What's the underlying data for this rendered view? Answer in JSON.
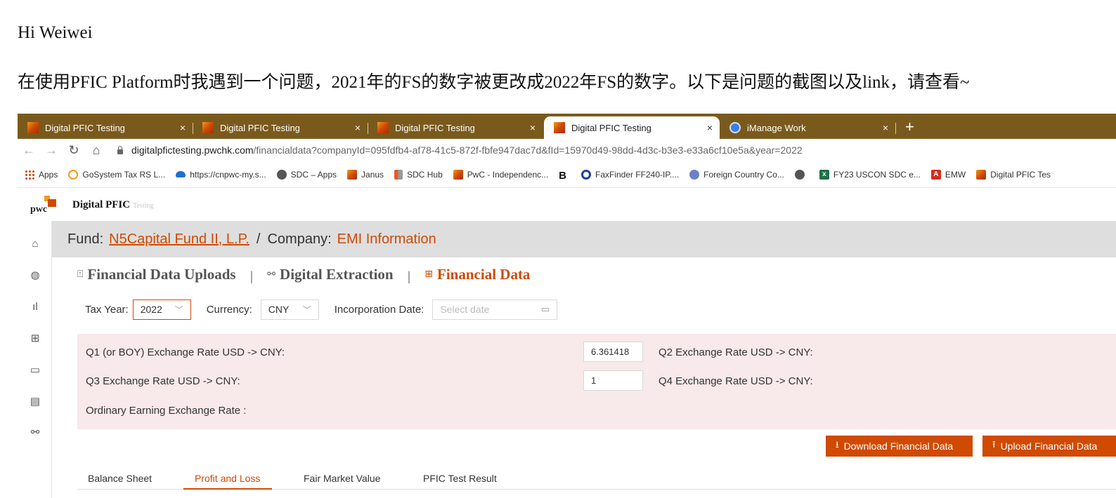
{
  "email": {
    "greeting": "Hi Weiwei",
    "message": "在使用PFIC Platform时我遇到一个问题，2021年的FS的数字被更改成2022年FS的数字。以下是问题的截图以及link，请查看~"
  },
  "browser": {
    "tabs": [
      {
        "title": "Digital PFIC Testing",
        "icon": "pwc-favicon"
      },
      {
        "title": "Digital PFIC Testing",
        "icon": "pwc-favicon"
      },
      {
        "title": "Digital PFIC Testing",
        "icon": "pwc-favicon"
      },
      {
        "title": "Digital PFIC Testing",
        "icon": "pwc-favicon",
        "active": true
      },
      {
        "title": "iManage Work",
        "icon": "imanage-favicon"
      }
    ],
    "close_glyph": "×",
    "new_tab_glyph": "+",
    "address": {
      "host": "digitalpfictesting.pwchk.com",
      "path": "/financialdata?companyId=095fdfb4-af78-41c5-872f-fbfe947dac7d&fId=15970d49-98dd-4d3c-b3e3-e33a6cf10e5a&year=2022"
    },
    "bookmarks": [
      {
        "label": "Apps",
        "icon": "apps-grid-icon"
      },
      {
        "label": "GoSystem Tax RS L...",
        "icon": "gosystem-icon"
      },
      {
        "label": "https://cnpwc-my.s...",
        "icon": "onedrive-cloud-icon"
      },
      {
        "label": "SDC – Apps",
        "icon": "globe-icon"
      },
      {
        "label": "Janus",
        "icon": "pwc-favicon"
      },
      {
        "label": "SDC Hub",
        "icon": "hub-icon"
      },
      {
        "label": "PwC - Independenc...",
        "icon": "pwc-favicon"
      },
      {
        "label": "",
        "icon": "bold-b-icon",
        "glyph": "B"
      },
      {
        "label": "FaxFinder FF240-IP....",
        "icon": "faxfinder-icon"
      },
      {
        "label": "Foreign Country Co...",
        "icon": "foreign-icon"
      },
      {
        "label": "",
        "icon": "globe-icon"
      },
      {
        "label": "FY23 USCON SDC e...",
        "icon": "excel-icon",
        "glyph": "x"
      },
      {
        "label": "EMW",
        "icon": "pdf-icon",
        "glyph": "A"
      },
      {
        "label": "Digital PFIC Tes",
        "icon": "pwc-favicon"
      }
    ]
  },
  "app": {
    "logo_text": "pwc",
    "title": "Digital PFIC",
    "subtitle": "Testing",
    "fund_label": "Fund:",
    "fund_name": "N5Capital Fund II, L.P.",
    "breadcrumb_sep": "/",
    "company_label": "Company:",
    "company_name": "EMI Information",
    "nav": {
      "uploads": "Financial Data Uploads",
      "extraction": "Digital Extraction",
      "financial": "Financial Data",
      "divider": "|"
    },
    "filters": {
      "tax_year_label": "Tax Year:",
      "tax_year_value": "2022",
      "currency_label": "Currency:",
      "currency_value": "CNY",
      "incorporation_label": "Incorporation Date:",
      "date_placeholder": "Select date"
    },
    "rates": {
      "q1_label": "Q1 (or BOY) Exchange Rate USD -> CNY:",
      "q1_value": "6.361418",
      "q2_label": "Q2 Exchange Rate USD -> CNY:",
      "q3_label": "Q3 Exchange Rate USD -> CNY:",
      "q3_value": "1",
      "q4_label": "Q4 Exchange Rate USD -> CNY:",
      "ordinary_label": "Ordinary Earning Exchange Rate :"
    },
    "buttons": {
      "download": "Download Financial Data",
      "upload": "Upload Financial Data"
    },
    "subtabs": [
      "Balance Sheet",
      "Profit and Loss",
      "Fair Market Value",
      "PFIC Test Result"
    ],
    "active_subtab": "Profit and Loss"
  },
  "colors": {
    "accent": "#d04a02",
    "tabstrip": "#7a5a1c",
    "rate_panel": "#f8e9ea",
    "fund_bar": "#dedede"
  }
}
